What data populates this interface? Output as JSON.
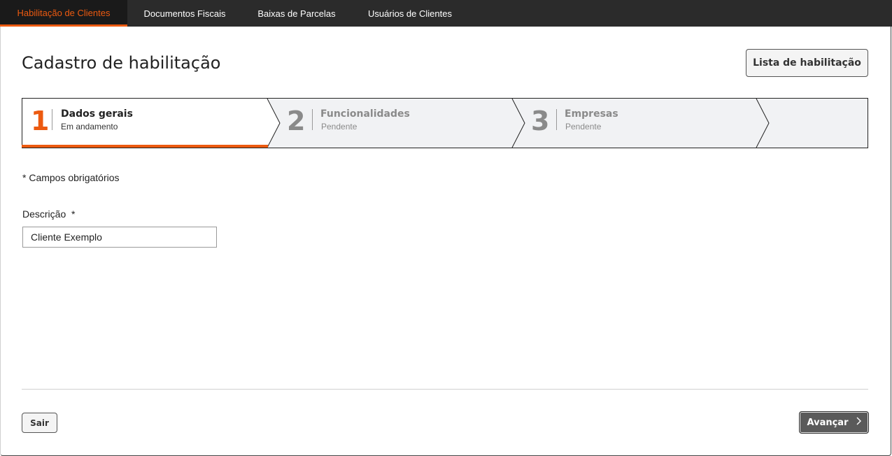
{
  "nav": {
    "tabs": [
      {
        "label": "Habilitação de Clientes",
        "active": true
      },
      {
        "label": "Documentos Fiscais",
        "active": false
      },
      {
        "label": "Baixas de Parcelas",
        "active": false
      },
      {
        "label": "Usuários de Clientes",
        "active": false
      }
    ]
  },
  "header": {
    "title": "Cadastro de habilitação",
    "list_button": "Lista de habilitação"
  },
  "stepper": {
    "steps": [
      {
        "number": "1",
        "title": "Dados gerais",
        "status": "Em andamento",
        "state": "active"
      },
      {
        "number": "2",
        "title": "Funcionalidades",
        "status": "Pendente",
        "state": "pending"
      },
      {
        "number": "3",
        "title": "Empresas",
        "status": "Pendente",
        "state": "pending"
      }
    ]
  },
  "form": {
    "required_note": "* Campos obrigatórios",
    "description_label": "Descrição",
    "required_mark": "*",
    "description_value": "Cliente Exemplo"
  },
  "footer": {
    "exit_label": "Sair",
    "next_label": "Avançar",
    "next_icon": "chevron-right-icon"
  },
  "colors": {
    "accent": "#ec5a10",
    "nav_bg": "#2b2b2b",
    "pending_text": "#8a8a8a",
    "pending_bg": "#f1f2f4"
  }
}
